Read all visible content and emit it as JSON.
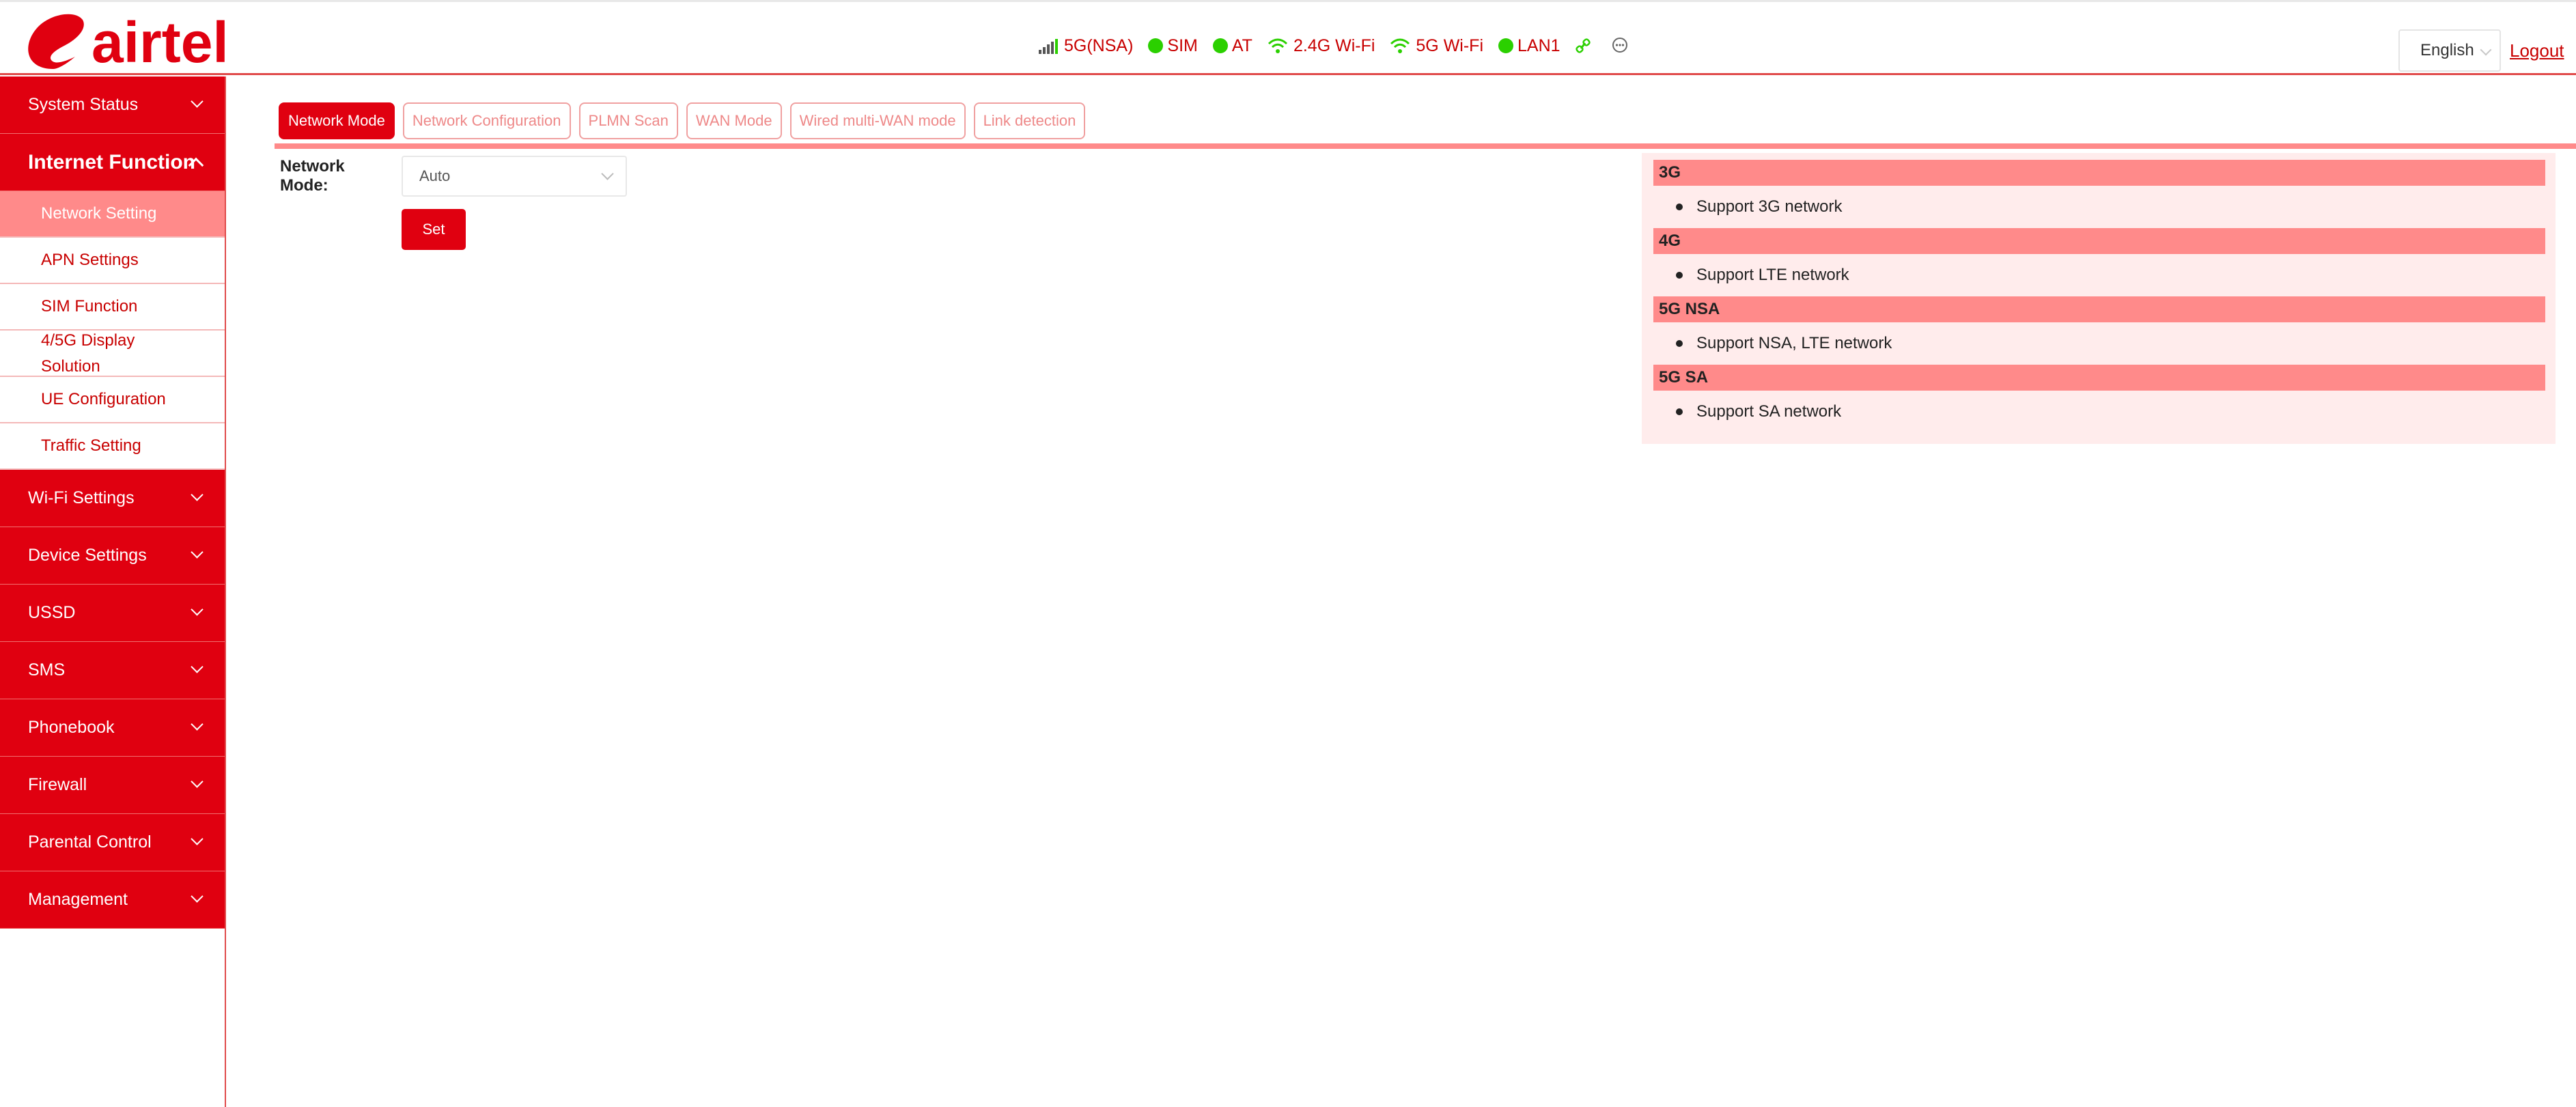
{
  "brand": {
    "name": "airtel"
  },
  "status_bar": {
    "items": [
      {
        "label": "5G(NSA)",
        "icon": "signal-icon"
      },
      {
        "label": "SIM",
        "icon": "status-dot-icon"
      },
      {
        "label": "AT",
        "icon": "status-dot-icon"
      },
      {
        "label": "2.4G Wi-Fi",
        "icon": "wifi-icon"
      },
      {
        "label": "5G Wi-Fi",
        "icon": "wifi-icon"
      },
      {
        "label": "LAN1",
        "icon": "status-dot-icon"
      }
    ],
    "link_icon": "link-icon",
    "message_icon": "message-icon"
  },
  "header": {
    "language": "English",
    "logout": "Logout"
  },
  "sidebar": {
    "system_status": "System Status",
    "internet_function": "Internet Function",
    "sub_items": [
      "Network Setting",
      "APN Settings",
      "SIM Function",
      "4/5G Display Solution",
      "UE Configuration",
      "Traffic Setting"
    ],
    "groups": [
      "Wi-Fi Settings",
      "Device Settings",
      "USSD",
      "SMS",
      "Phonebook",
      "Firewall",
      "Parental Control",
      "Management"
    ]
  },
  "tabs": [
    "Network Mode",
    "Network Configuration",
    "PLMN Scan",
    "WAN Mode",
    "Wired multi-WAN mode",
    "Link detection"
  ],
  "form": {
    "label": "Network Mode:",
    "value": "Auto",
    "set_button": "Set"
  },
  "info": [
    {
      "title": "3G",
      "desc": "Support 3G network"
    },
    {
      "title": "4G",
      "desc": "Support LTE network"
    },
    {
      "title": "5G NSA",
      "desc": "Support NSA, LTE network"
    },
    {
      "title": "5G SA",
      "desc": "Support SA network"
    }
  ],
  "colors": {
    "accent": "#e00010",
    "light_accent": "#ff8a8a",
    "panel_bg": "#ffecec",
    "status_green": "#2bd000"
  }
}
